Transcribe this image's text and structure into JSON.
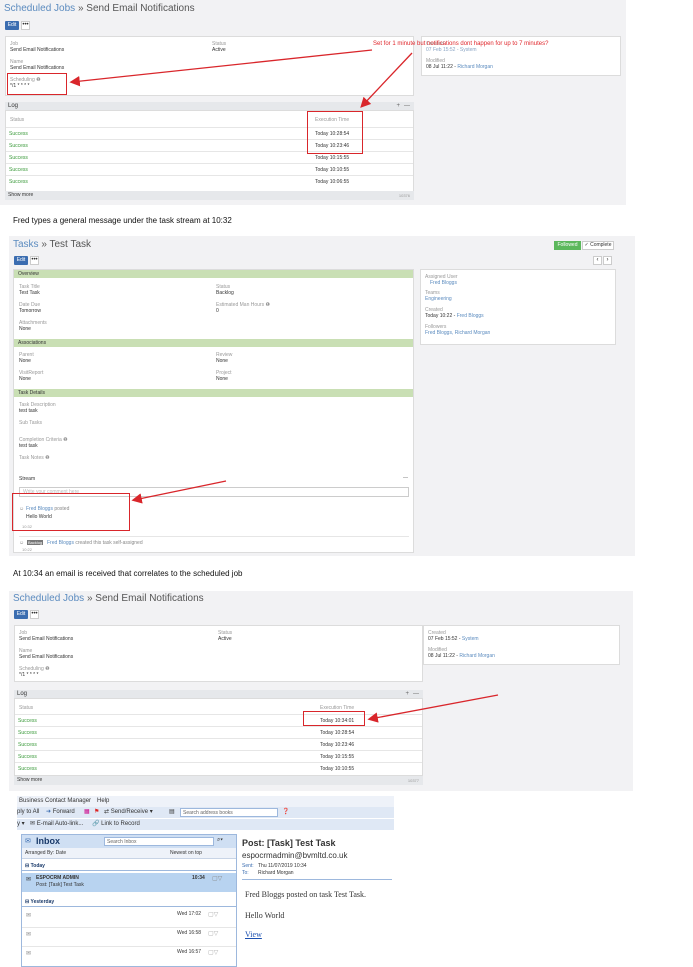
{
  "panel1": {
    "breadcrumb_root": "Scheduled Jobs",
    "breadcrumb_sep": " » ",
    "breadcrumb_current": "Send Email Notifications",
    "edit_label": "Edit",
    "more_label": "•••",
    "job_label": "Job",
    "job_value": "Send Email Notifications",
    "name_label": "Name",
    "name_value": "Send Email Notifications",
    "status_label": "Status",
    "status_value": "Active",
    "scheduling_label": "Scheduling ❶",
    "scheduling_value": "*/1 * * * *",
    "created_label": "Created",
    "created_value": "07 Feb 15:52 - System",
    "modified_label": "Modified",
    "modified_date": "08 Jul 11:22 -",
    "modified_user": "Richard Morgan",
    "log_title": "Log",
    "log_plus": "+",
    "log_minus": "—",
    "col_status": "Status",
    "col_exec": "Execution Time",
    "rows": [
      {
        "status": "Success",
        "time": "Today 10:28:54"
      },
      {
        "status": "Success",
        "time": "Today 10:23:46"
      },
      {
        "status": "Success",
        "time": "Today 10:15:55"
      },
      {
        "status": "Success",
        "time": "Today 10:10:55"
      },
      {
        "status": "Success",
        "time": "Today 10:06:55"
      }
    ],
    "show_more": "Show more",
    "total": "10376",
    "annotation": "Set for 1 minute but notifications dont happen for up to 7 minutes?"
  },
  "caption1": "Fred types a general message under the task stream at 10:32",
  "panel2": {
    "breadcrumb_root": "Tasks",
    "breadcrumb_sep": " » ",
    "breadcrumb_current": "Test Task",
    "followed_label": "Followed",
    "complete_label": "✓ Complete",
    "edit_label": "Edit",
    "more_label": "•••",
    "overview": "Overview",
    "task_title_label": "Task Title",
    "task_title_value": "Test Task",
    "status_label": "Status",
    "status_value": "Backlog",
    "date_due_label": "Date Due",
    "date_due_value": "Tomorrow",
    "est_hours_label": "Estimated Man Hours ❶",
    "est_hours_value": "0",
    "attachments_label": "Attachments",
    "attachments_value": "None",
    "associations": "Associations",
    "parent_label": "Parent",
    "parent_value": "None",
    "review_label": "Review",
    "review_value": "None",
    "visitreport_label": "VisitReport",
    "visitreport_value": "None",
    "project_label": "Project",
    "project_value": "None",
    "task_details": "Task Details",
    "desc_label": "Task Description",
    "desc_value": "test task",
    "subtasks_label": "Sub Tasks",
    "completion_label": "Completion Criteria ❶",
    "completion_value": "test task",
    "notes_label": "Task Notes ❶",
    "stream_label": "Stream",
    "stream_minus": "—",
    "post_placeholder": "Write your comment here",
    "post_user": "Fred Bloggs",
    "post_verb": "posted",
    "post_text": "Hello World",
    "post_time": "10:32",
    "created_badge": "Backlog",
    "created_user": "Fred Bloggs",
    "created_text": "created this task self-assigned",
    "created_time": "10:22",
    "assigned_label": "Assigned User",
    "assigned_value": "Fred Bloggs",
    "teams_label": "Teams",
    "teams_value": "Engineering",
    "created_label": "Created",
    "created_date": "Today 10:22 -",
    "created_by": "Fred Bloggs",
    "followers_label": "Followers",
    "followers_value": "Fred Bloggs, Richard Morgan"
  },
  "caption2": "At 10:34 an email is received that correlates to the scheduled job",
  "panel3": {
    "breadcrumb_root": "Scheduled Jobs",
    "breadcrumb_sep": " » ",
    "breadcrumb_current": "Send Email Notifications",
    "edit_label": "Edit",
    "more_label": "•••",
    "job_label": "Job",
    "job_value": "Send Email Notifications",
    "name_label": "Name",
    "name_value": "Send Email Notifications",
    "status_label": "Status",
    "status_value": "Active",
    "scheduling_label": "Scheduling ❶",
    "scheduling_value": "*/1 * * * *",
    "created_label": "Created",
    "created_date": "07 Feb 15:52 -",
    "created_user": "System",
    "modified_label": "Modified",
    "modified_date": "08 Jul 11:22 -",
    "modified_user": "Richard Morgan",
    "log_title": "Log",
    "log_plus": "+",
    "log_minus": "—",
    "col_status": "Status",
    "col_exec": "Execution Time",
    "rows": [
      {
        "status": "Success",
        "time": "Today 10:34:01"
      },
      {
        "status": "Success",
        "time": "Today 10:28:54"
      },
      {
        "status": "Success",
        "time": "Today 10:23:46"
      },
      {
        "status": "Success",
        "time": "Today 10:15:55"
      },
      {
        "status": "Success",
        "time": "Today 10:10:55"
      }
    ],
    "show_more": "Show more",
    "total": "10377"
  },
  "outlook": {
    "menu_bcm": "Business Contact Manager",
    "menu_help": "Help",
    "reply_all": "ply to All",
    "forward": "Forward",
    "send_receive": "Send/Receive",
    "search_books_placeholder": "Search address books",
    "email_autolink": "E-mail Auto-link...",
    "link_to_record": "Link to Record",
    "inbox_title": "Inbox",
    "search_inbox_placeholder": "Search Inbox",
    "arranged_by": "Arranged By: Date",
    "sort_order": "Newest on top",
    "group_today": "Today",
    "msg_from": "ESPOCRM ADMIN",
    "msg_subject": "Post: [Task] Test Task",
    "msg_time": "10:34",
    "group_yesterday": "Yesterday",
    "older": [
      {
        "time": "Wed 17:02"
      },
      {
        "time": "Wed 16:58"
      },
      {
        "time": "Wed 16:57"
      }
    ],
    "reading_subject": "Post: [Task] Test Task",
    "reading_from": "espocrmadmin@bvmltd.co.uk",
    "sent_label": "Sent:",
    "sent_value": "Thu 11/07/2019 10:34",
    "to_label": "To:",
    "to_value": "Richard Morgan",
    "body_line1": "Fred Bloggs posted on task Test Task.",
    "body_line2": "Hello World",
    "body_link": "View"
  },
  "colors": {
    "accent_blue": "#3b6db0",
    "link_blue": "#5b8bbf",
    "success_green": "#3b9a3b",
    "annotation_red": "#d9262b",
    "section_green": "#c9dfb4"
  }
}
